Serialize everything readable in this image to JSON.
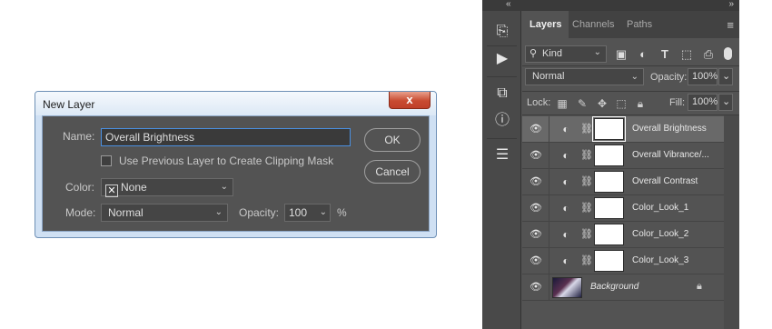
{
  "dialog": {
    "title": "New Layer",
    "close_label": "x",
    "name_label": "Name:",
    "name_value": "Overall Brightness",
    "clip_label": "Use Previous Layer to Create Clipping Mask",
    "clip_checked": false,
    "color_label": "Color:",
    "color_value": "None",
    "mode_label": "Mode:",
    "mode_value": "Normal",
    "opacity_label": "Opacity:",
    "opacity_value": "100",
    "opacity_unit": "%",
    "ok_label": "OK",
    "cancel_label": "Cancel"
  },
  "panel": {
    "tabs": [
      {
        "label": "Layers",
        "active": true
      },
      {
        "label": "Channels",
        "active": false
      },
      {
        "label": "Paths",
        "active": false
      }
    ],
    "filter_kind": "Kind",
    "blend_mode": "Normal",
    "opacity_label": "Opacity:",
    "opacity_value": "100%",
    "lock_label": "Lock:",
    "fill_label": "Fill:",
    "fill_value": "100%",
    "layers": [
      {
        "name": "Overall Brightness",
        "type": "adjustment",
        "selected": true
      },
      {
        "name": "Overall Vibrance/...",
        "type": "adjustment",
        "selected": false
      },
      {
        "name": "Overall Contrast",
        "type": "adjustment",
        "selected": false
      },
      {
        "name": "Color_Look_1",
        "type": "adjustment",
        "selected": false
      },
      {
        "name": "Color_Look_2",
        "type": "adjustment",
        "selected": false
      },
      {
        "name": "Color_Look_3",
        "type": "adjustment",
        "selected": false
      },
      {
        "name": "Background",
        "type": "background",
        "selected": false,
        "locked": true
      }
    ]
  },
  "icons": {
    "collapse_left": "«",
    "collapse_right": "»",
    "panel_menu": "≡"
  }
}
